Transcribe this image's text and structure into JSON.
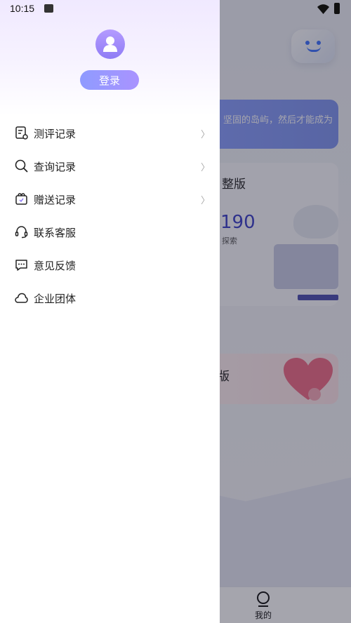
{
  "status_bar": {
    "time": "10:15"
  },
  "drawer": {
    "login_label": "登录",
    "menu": [
      {
        "label": "测评记录",
        "icon": "report-icon",
        "has_chevron": true
      },
      {
        "label": "查询记录",
        "icon": "search-icon",
        "has_chevron": true
      },
      {
        "label": "赠送记录",
        "icon": "gift-icon",
        "has_chevron": true
      },
      {
        "label": "联系客服",
        "icon": "headset-icon",
        "has_chevron": false
      },
      {
        "label": "意见反馈",
        "icon": "feedback-icon",
        "has_chevron": false
      },
      {
        "label": "企业团体",
        "icon": "cloud-icon",
        "has_chevron": false
      }
    ],
    "chevron": "〉"
  },
  "background": {
    "banner_text": "坚固的岛屿，然后才能成为",
    "card1_title": "整版",
    "card1_price": "190",
    "card1_sub": "探索",
    "card2_title": "版",
    "tab_label": "我的"
  },
  "colors": {
    "accent": "#9a8fff",
    "avatar": "#a48cff",
    "scrim": "#1e1e32"
  }
}
